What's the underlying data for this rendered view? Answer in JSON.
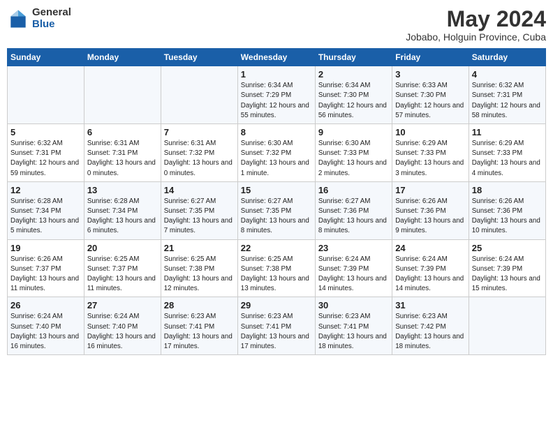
{
  "logo": {
    "general": "General",
    "blue": "Blue"
  },
  "title": "May 2024",
  "location": "Jobabo, Holguin Province, Cuba",
  "weekdays": [
    "Sunday",
    "Monday",
    "Tuesday",
    "Wednesday",
    "Thursday",
    "Friday",
    "Saturday"
  ],
  "weeks": [
    [
      {
        "day": "",
        "sunrise": "",
        "sunset": "",
        "daylight": ""
      },
      {
        "day": "",
        "sunrise": "",
        "sunset": "",
        "daylight": ""
      },
      {
        "day": "",
        "sunrise": "",
        "sunset": "",
        "daylight": ""
      },
      {
        "day": "1",
        "sunrise": "Sunrise: 6:34 AM",
        "sunset": "Sunset: 7:29 PM",
        "daylight": "Daylight: 12 hours and 55 minutes."
      },
      {
        "day": "2",
        "sunrise": "Sunrise: 6:34 AM",
        "sunset": "Sunset: 7:30 PM",
        "daylight": "Daylight: 12 hours and 56 minutes."
      },
      {
        "day": "3",
        "sunrise": "Sunrise: 6:33 AM",
        "sunset": "Sunset: 7:30 PM",
        "daylight": "Daylight: 12 hours and 57 minutes."
      },
      {
        "day": "4",
        "sunrise": "Sunrise: 6:32 AM",
        "sunset": "Sunset: 7:31 PM",
        "daylight": "Daylight: 12 hours and 58 minutes."
      }
    ],
    [
      {
        "day": "5",
        "sunrise": "Sunrise: 6:32 AM",
        "sunset": "Sunset: 7:31 PM",
        "daylight": "Daylight: 12 hours and 59 minutes."
      },
      {
        "day": "6",
        "sunrise": "Sunrise: 6:31 AM",
        "sunset": "Sunset: 7:31 PM",
        "daylight": "Daylight: 13 hours and 0 minutes."
      },
      {
        "day": "7",
        "sunrise": "Sunrise: 6:31 AM",
        "sunset": "Sunset: 7:32 PM",
        "daylight": "Daylight: 13 hours and 0 minutes."
      },
      {
        "day": "8",
        "sunrise": "Sunrise: 6:30 AM",
        "sunset": "Sunset: 7:32 PM",
        "daylight": "Daylight: 13 hours and 1 minute."
      },
      {
        "day": "9",
        "sunrise": "Sunrise: 6:30 AM",
        "sunset": "Sunset: 7:33 PM",
        "daylight": "Daylight: 13 hours and 2 minutes."
      },
      {
        "day": "10",
        "sunrise": "Sunrise: 6:29 AM",
        "sunset": "Sunset: 7:33 PM",
        "daylight": "Daylight: 13 hours and 3 minutes."
      },
      {
        "day": "11",
        "sunrise": "Sunrise: 6:29 AM",
        "sunset": "Sunset: 7:33 PM",
        "daylight": "Daylight: 13 hours and 4 minutes."
      }
    ],
    [
      {
        "day": "12",
        "sunrise": "Sunrise: 6:28 AM",
        "sunset": "Sunset: 7:34 PM",
        "daylight": "Daylight: 13 hours and 5 minutes."
      },
      {
        "day": "13",
        "sunrise": "Sunrise: 6:28 AM",
        "sunset": "Sunset: 7:34 PM",
        "daylight": "Daylight: 13 hours and 6 minutes."
      },
      {
        "day": "14",
        "sunrise": "Sunrise: 6:27 AM",
        "sunset": "Sunset: 7:35 PM",
        "daylight": "Daylight: 13 hours and 7 minutes."
      },
      {
        "day": "15",
        "sunrise": "Sunrise: 6:27 AM",
        "sunset": "Sunset: 7:35 PM",
        "daylight": "Daylight: 13 hours and 8 minutes."
      },
      {
        "day": "16",
        "sunrise": "Sunrise: 6:27 AM",
        "sunset": "Sunset: 7:36 PM",
        "daylight": "Daylight: 13 hours and 8 minutes."
      },
      {
        "day": "17",
        "sunrise": "Sunrise: 6:26 AM",
        "sunset": "Sunset: 7:36 PM",
        "daylight": "Daylight: 13 hours and 9 minutes."
      },
      {
        "day": "18",
        "sunrise": "Sunrise: 6:26 AM",
        "sunset": "Sunset: 7:36 PM",
        "daylight": "Daylight: 13 hours and 10 minutes."
      }
    ],
    [
      {
        "day": "19",
        "sunrise": "Sunrise: 6:26 AM",
        "sunset": "Sunset: 7:37 PM",
        "daylight": "Daylight: 13 hours and 11 minutes."
      },
      {
        "day": "20",
        "sunrise": "Sunrise: 6:25 AM",
        "sunset": "Sunset: 7:37 PM",
        "daylight": "Daylight: 13 hours and 11 minutes."
      },
      {
        "day": "21",
        "sunrise": "Sunrise: 6:25 AM",
        "sunset": "Sunset: 7:38 PM",
        "daylight": "Daylight: 13 hours and 12 minutes."
      },
      {
        "day": "22",
        "sunrise": "Sunrise: 6:25 AM",
        "sunset": "Sunset: 7:38 PM",
        "daylight": "Daylight: 13 hours and 13 minutes."
      },
      {
        "day": "23",
        "sunrise": "Sunrise: 6:24 AM",
        "sunset": "Sunset: 7:39 PM",
        "daylight": "Daylight: 13 hours and 14 minutes."
      },
      {
        "day": "24",
        "sunrise": "Sunrise: 6:24 AM",
        "sunset": "Sunset: 7:39 PM",
        "daylight": "Daylight: 13 hours and 14 minutes."
      },
      {
        "day": "25",
        "sunrise": "Sunrise: 6:24 AM",
        "sunset": "Sunset: 7:39 PM",
        "daylight": "Daylight: 13 hours and 15 minutes."
      }
    ],
    [
      {
        "day": "26",
        "sunrise": "Sunrise: 6:24 AM",
        "sunset": "Sunset: 7:40 PM",
        "daylight": "Daylight: 13 hours and 16 minutes."
      },
      {
        "day": "27",
        "sunrise": "Sunrise: 6:24 AM",
        "sunset": "Sunset: 7:40 PM",
        "daylight": "Daylight: 13 hours and 16 minutes."
      },
      {
        "day": "28",
        "sunrise": "Sunrise: 6:23 AM",
        "sunset": "Sunset: 7:41 PM",
        "daylight": "Daylight: 13 hours and 17 minutes."
      },
      {
        "day": "29",
        "sunrise": "Sunrise: 6:23 AM",
        "sunset": "Sunset: 7:41 PM",
        "daylight": "Daylight: 13 hours and 17 minutes."
      },
      {
        "day": "30",
        "sunrise": "Sunrise: 6:23 AM",
        "sunset": "Sunset: 7:41 PM",
        "daylight": "Daylight: 13 hours and 18 minutes."
      },
      {
        "day": "31",
        "sunrise": "Sunrise: 6:23 AM",
        "sunset": "Sunset: 7:42 PM",
        "daylight": "Daylight: 13 hours and 18 minutes."
      },
      {
        "day": "",
        "sunrise": "",
        "sunset": "",
        "daylight": ""
      }
    ]
  ]
}
